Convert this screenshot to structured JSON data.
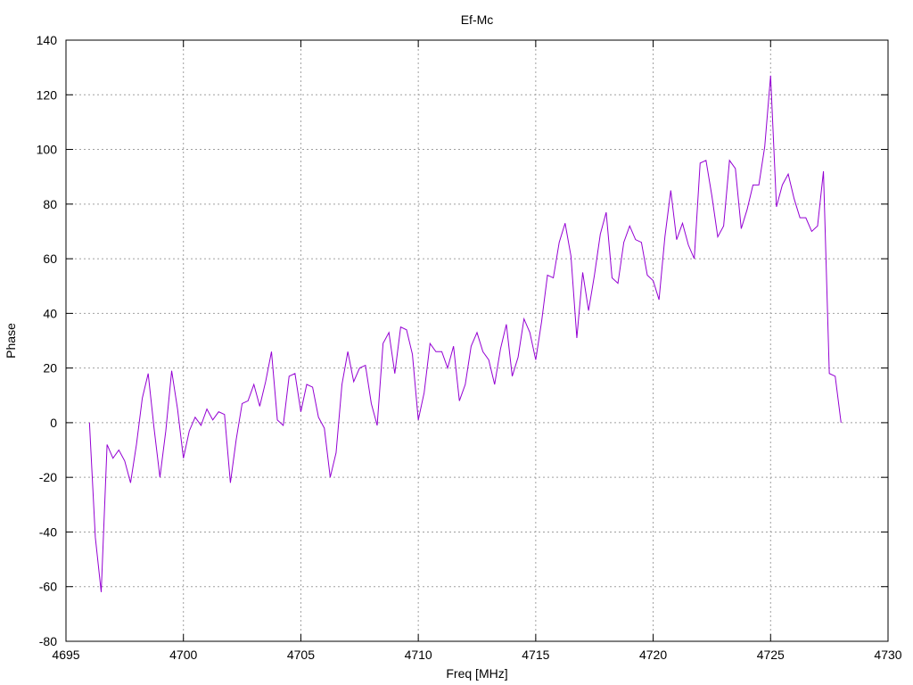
{
  "chart_data": {
    "type": "line",
    "title": "Ef-Mc",
    "xlabel": "Freq [MHz]",
    "ylabel": "Phase",
    "xlim": [
      4695,
      4730
    ],
    "ylim": [
      -80,
      140
    ],
    "xticks": [
      4695,
      4700,
      4705,
      4710,
      4715,
      4720,
      4725,
      4730
    ],
    "yticks": [
      -80,
      -60,
      -40,
      -20,
      0,
      20,
      40,
      60,
      80,
      100,
      120,
      140
    ],
    "grid": true,
    "grid_style": "dotted",
    "line_color": "#9400d3",
    "series": [
      {
        "x": [
          4696.0,
          4696.25,
          4696.5,
          4696.75,
          4697.0,
          4697.25,
          4697.5,
          4697.75,
          4698.0,
          4698.25,
          4698.5,
          4698.75,
          4699.0,
          4699.25,
          4699.5,
          4699.75,
          4700.0,
          4700.25,
          4700.5,
          4700.75,
          4701.0,
          4701.25,
          4701.5,
          4701.75,
          4702.0,
          4702.25,
          4702.5,
          4702.75,
          4703.0,
          4703.25,
          4703.5,
          4703.75,
          4704.0,
          4704.25,
          4704.5,
          4704.75,
          4705.0,
          4705.25,
          4705.5,
          4705.75,
          4706.0,
          4706.25,
          4706.5,
          4706.75,
          4707.0,
          4707.25,
          4707.5,
          4707.75,
          4708.0,
          4708.25,
          4708.5,
          4708.75,
          4709.0,
          4709.25,
          4709.5,
          4709.75,
          4710.0,
          4710.25,
          4710.5,
          4710.75,
          4711.0,
          4711.25,
          4711.5,
          4711.75,
          4712.0,
          4712.25,
          4712.5,
          4712.75,
          4713.0,
          4713.25,
          4713.5,
          4713.75,
          4714.0,
          4714.25,
          4714.5,
          4714.75,
          4715.0,
          4715.25,
          4715.5,
          4715.75,
          4716.0,
          4716.25,
          4716.5,
          4716.75,
          4717.0,
          4717.25,
          4717.5,
          4717.75,
          4718.0,
          4718.25,
          4718.5,
          4718.75,
          4719.0,
          4719.25,
          4719.5,
          4719.75,
          4720.0,
          4720.25,
          4720.5,
          4720.75,
          4721.0,
          4721.25,
          4721.5,
          4721.75,
          4722.0,
          4722.25,
          4722.5,
          4722.75,
          4723.0,
          4723.25,
          4723.5,
          4723.75,
          4724.0,
          4724.25,
          4724.5,
          4724.75,
          4725.0,
          4725.25,
          4725.5,
          4725.75,
          4726.0,
          4726.25,
          4726.5,
          4726.75,
          4727.0,
          4727.25,
          4727.5,
          4727.75,
          4728.0
        ],
        "y": [
          0,
          -42,
          -62,
          -8,
          -13,
          -10,
          -14,
          -22,
          -8,
          9,
          18,
          -2,
          -20,
          -3,
          19,
          5,
          -13,
          -3,
          2,
          -1,
          5,
          1,
          4,
          3,
          -22,
          -6,
          7,
          8,
          14,
          6,
          15,
          26,
          1,
          -1,
          17,
          18,
          4,
          14,
          13,
          2,
          -2,
          -20,
          -11,
          14,
          26,
          15,
          20,
          21,
          7,
          -1,
          29,
          33,
          18,
          35,
          34,
          25,
          1,
          11,
          29,
          26,
          26,
          20,
          28,
          8,
          14,
          28,
          33,
          26,
          23,
          14,
          27,
          36,
          17,
          24,
          38,
          33,
          23,
          37,
          54,
          53,
          66,
          73,
          61,
          31,
          55,
          41,
          54,
          69,
          77,
          53,
          51,
          66,
          72,
          67,
          66,
          54,
          52,
          45,
          68,
          85,
          67,
          73,
          65,
          60,
          95,
          96,
          83,
          68,
          72,
          96,
          93,
          71,
          78,
          87,
          87,
          101,
          127,
          79,
          87,
          91,
          82,
          75,
          75,
          70,
          72,
          92,
          18,
          17,
          0
        ]
      }
    ]
  }
}
